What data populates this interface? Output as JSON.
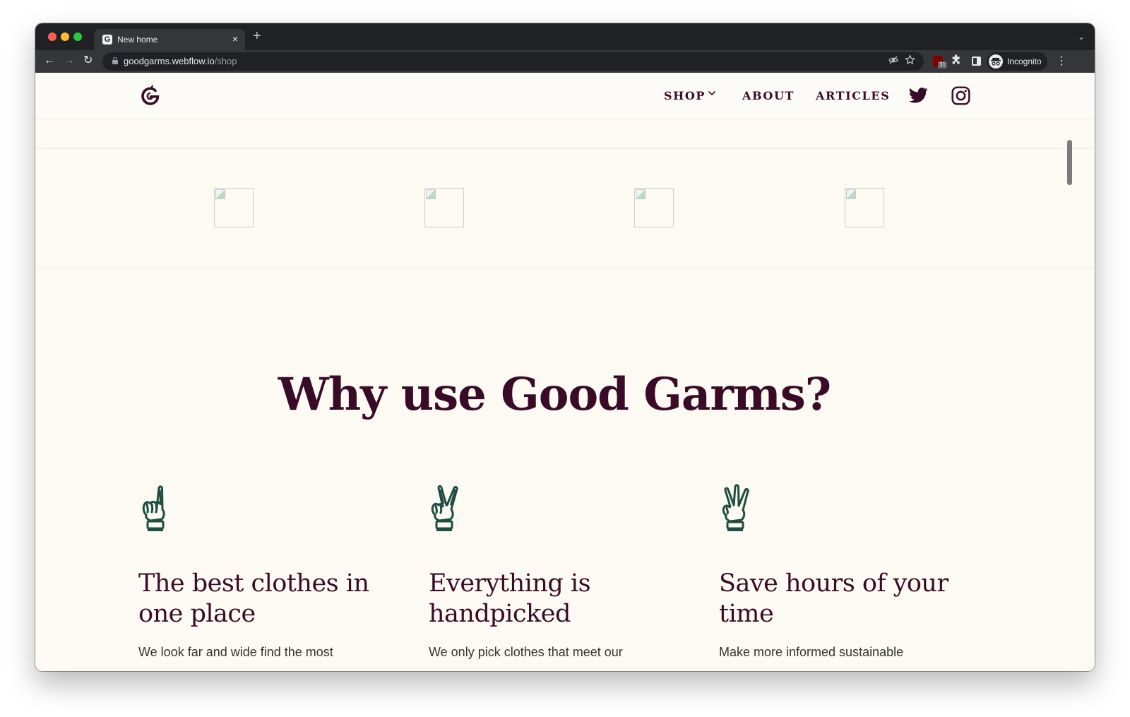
{
  "browser": {
    "tab_title": "New home",
    "tab_favicon": "G",
    "close_glyph": "×",
    "new_tab_glyph": "+",
    "tab_menu_glyph": "⌄",
    "back_glyph": "←",
    "forward_glyph": "→",
    "reload_glyph": "↻",
    "url_host": "goodgarms.webflow.io",
    "url_path": "/shop",
    "ublock_badge": "31",
    "incognito_label": "Incognito",
    "menu_glyph": "⋮",
    "icons": [
      "lock-icon",
      "eye-off-icon",
      "star-icon",
      "ublock-icon",
      "puzzle-icon",
      "side-panel-icon",
      "incognito-icon"
    ],
    "colors": {
      "frame": "#202124",
      "toolbar": "#35363a",
      "text": "#e8eaed"
    }
  },
  "site": {
    "logo": "good-garms-logo",
    "nav": {
      "shop": "SHOP",
      "about": "ABOUT",
      "articles": "ARTICLES"
    },
    "social_icons": [
      "twitter-icon",
      "instagram-icon"
    ],
    "colors": {
      "primary": "#3a0b26",
      "accent": "#1e4d41",
      "background": "#fcfaf2"
    }
  },
  "section": {
    "title": "Why use Good Garms?",
    "features": [
      {
        "icon": "one-finger-hand-icon",
        "title": "The best clothes in one place",
        "desc": "We look far and wide find the most"
      },
      {
        "icon": "two-finger-hand-icon",
        "title": "Everything is handpicked",
        "desc": "We only pick clothes that meet our"
      },
      {
        "icon": "three-finger-hand-icon",
        "title": "Save hours of your time",
        "desc": "Make more informed sustainable"
      }
    ]
  }
}
